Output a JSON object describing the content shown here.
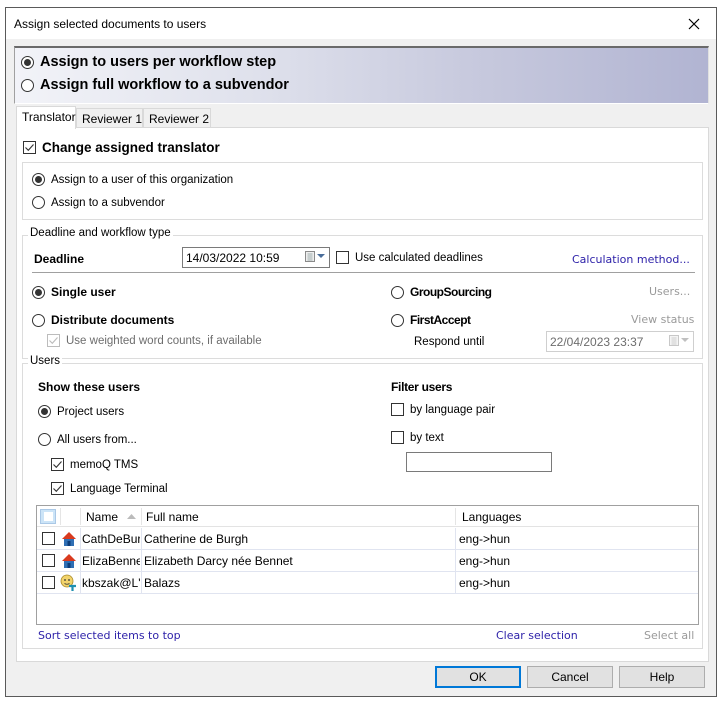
{
  "window": {
    "title": "Assign selected documents to users",
    "close_icon": "close-icon"
  },
  "mode": {
    "options": [
      {
        "label": "Assign to users per workflow step",
        "checked": true
      },
      {
        "label": "Assign full workflow to a subvendor",
        "checked": false
      }
    ]
  },
  "tabs": [
    {
      "label": "Translator",
      "active": true
    },
    {
      "label": "Reviewer 1",
      "active": false
    },
    {
      "label": "Reviewer 2",
      "active": false
    }
  ],
  "translator": {
    "change_assigned_label": "Change assigned translator",
    "change_assigned_checked": true,
    "assign_options": [
      {
        "label": "Assign to a user of this organization",
        "checked": true
      },
      {
        "label": "Assign to a subvendor",
        "checked": false
      }
    ]
  },
  "deadline_group": {
    "legend": "Deadline and workflow type",
    "deadline_label": "Deadline",
    "deadline_value": "14/03/2022 10:59",
    "use_calculated_label": "Use calculated deadlines",
    "use_calculated_checked": false,
    "calculation_method_link": "Calculation method...",
    "workflow_types": {
      "single_user": {
        "label": "Single user",
        "checked": true
      },
      "distribute": {
        "label": "Distribute documents",
        "checked": false
      },
      "groupsourcing": {
        "label": "GroupSourcing",
        "checked": false
      },
      "firstaccept": {
        "label": "FirstAccept",
        "checked": false
      }
    },
    "weighted_label": "Use weighted word counts, if available",
    "weighted_checked": true,
    "users_link": "Users...",
    "view_status_link": "View status",
    "respond_until_label": "Respond until",
    "respond_until_value": "22/04/2023 23:37"
  },
  "users_group": {
    "legend": "Users",
    "show_heading": "Show these users",
    "show_options": [
      {
        "label": "Project users",
        "checked": true
      },
      {
        "label": "All users from...",
        "checked": false
      }
    ],
    "sources": [
      {
        "label": "memoQ TMS",
        "checked": true
      },
      {
        "label": "Language Terminal",
        "checked": true
      }
    ],
    "filter_heading": "Filter users",
    "filter_options": [
      {
        "label": "by language pair",
        "checked": false
      },
      {
        "label": "by text",
        "checked": false
      }
    ],
    "filter_text_value": ""
  },
  "grid": {
    "columns": [
      "Name",
      "Full name",
      "Languages"
    ],
    "sort_column": "Name",
    "sort_direction": "ascending",
    "rows": [
      {
        "checked": false,
        "icon": "house-icon",
        "name": "CathDeBur",
        "full_name": "Catherine de Burgh",
        "languages": "eng->hun"
      },
      {
        "checked": false,
        "icon": "house-icon",
        "name": "ElizaBenne",
        "full_name": "Elizabeth Darcy née Bennet",
        "languages": "eng->hun"
      },
      {
        "checked": false,
        "icon": "lt-user-icon",
        "name": "kbszak@L'",
        "full_name": "Balazs",
        "languages": "eng->hun"
      }
    ]
  },
  "links": {
    "sort_selected": "Sort selected items to top",
    "clear_selection": "Clear selection",
    "select_all": "Select all"
  },
  "buttons": {
    "ok": "OK",
    "cancel": "Cancel",
    "help": "Help"
  },
  "colors": {
    "link": "#2b1fa8",
    "disabled_link": "#9a9a9a",
    "default_button_border": "#0078d7"
  }
}
